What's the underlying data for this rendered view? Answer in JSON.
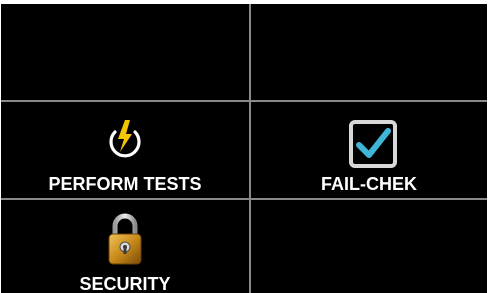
{
  "tiles": {
    "perform_tests": {
      "label": "PERFORM TESTS",
      "icon": "power-bolt-icon"
    },
    "fail_chek": {
      "label": "FAIL-CHEK",
      "icon": "checkbox-checked-icon"
    },
    "security": {
      "label": "SECURITY",
      "icon": "padlock-icon"
    }
  },
  "colors": {
    "background": "#000000",
    "grid_lines": "#8a8a8a",
    "label_text": "#ffffff",
    "bolt": "#f5c400",
    "check": "#3fb6d8",
    "lock_body": "#c98a1a"
  }
}
